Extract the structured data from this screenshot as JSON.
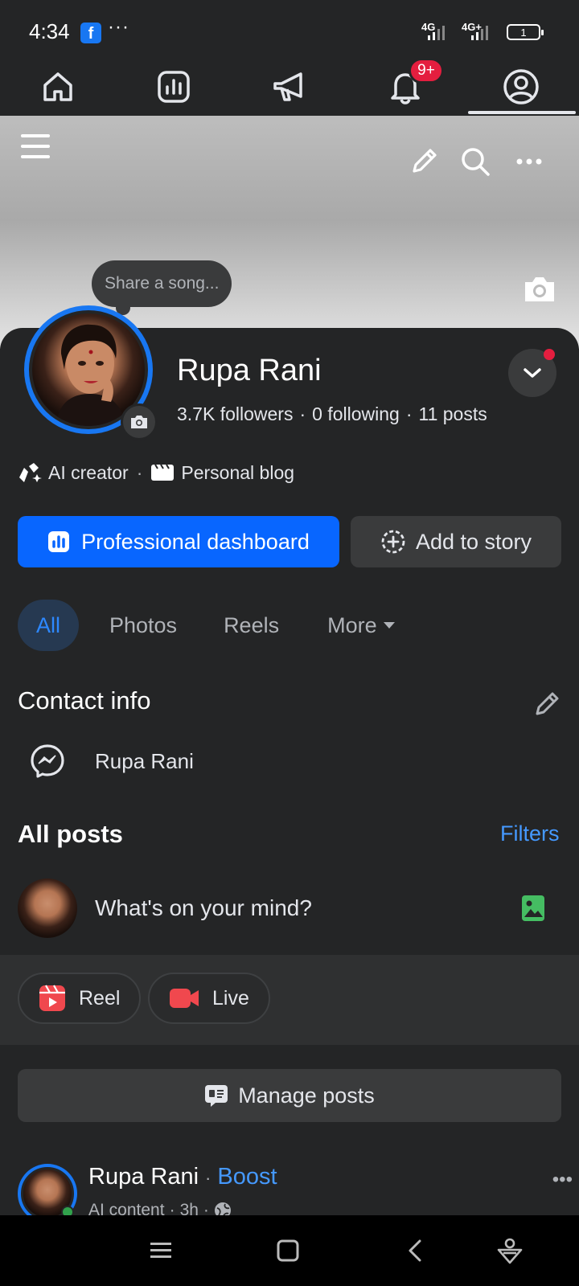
{
  "status_bar": {
    "time": "4:34",
    "fb_icon": "f",
    "dots": "···",
    "signal1": "4G",
    "signal2": "4G+",
    "battery": "1"
  },
  "top_nav": {
    "items": [
      "home-icon",
      "dashboard-icon",
      "megaphone-icon",
      "bell-icon",
      "profile-icon"
    ],
    "notification_badge": "9+"
  },
  "cover": {
    "icons": [
      "menu-icon",
      "edit-icon",
      "search-icon",
      "more-icon",
      "camera-icon"
    ]
  },
  "song_bubble": "Share a song...",
  "profile": {
    "name": "Rupa Rani",
    "followers": "3.7K followers",
    "following": "0 following",
    "posts": "11 posts",
    "stats_sep": "·",
    "tag1": "AI creator",
    "tag_sep": "·",
    "tag2": "Personal blog"
  },
  "buttons": {
    "professional_dashboard": "Professional dashboard",
    "add_to_story": "Add to story"
  },
  "tabs": [
    "All",
    "Photos",
    "Reels",
    "More"
  ],
  "contact_info": {
    "title": "Contact info",
    "messenger_name": "Rupa Rani"
  },
  "all_posts": {
    "title": "All posts",
    "filters": "Filters",
    "composer_placeholder": "What's on your mind?"
  },
  "actions": {
    "reel": "Reel",
    "live": "Live"
  },
  "manage_posts": "Manage posts",
  "post": {
    "author": "Rupa Rani",
    "dot": "·",
    "boost": "Boost",
    "meta_label": "AI content",
    "meta_sep": "·",
    "time": "3h",
    "more": "•••"
  },
  "colors": {
    "accent": "#0866ff",
    "link": "#4599ff",
    "badge": "#e41e3f",
    "background": "#242526"
  }
}
